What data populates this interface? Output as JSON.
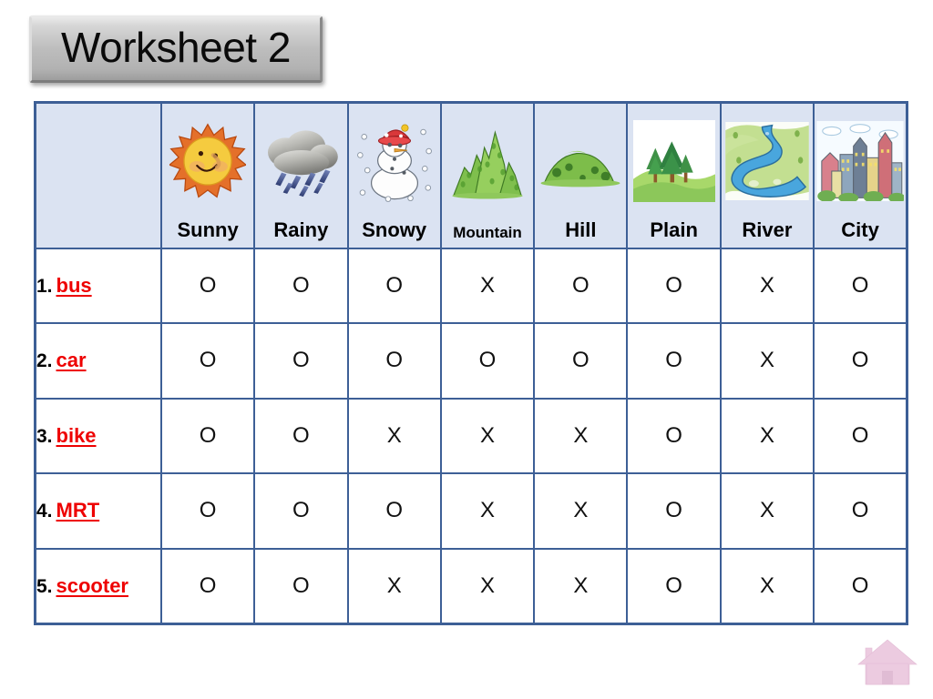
{
  "title": {
    "text": "Worksheet 2"
  },
  "table": {
    "corner_label": "",
    "columns": [
      {
        "label": "Sunny",
        "icon": "sun-icon",
        "label_size": "normal"
      },
      {
        "label": "Rainy",
        "icon": "rain-cloud-icon",
        "label_size": "normal"
      },
      {
        "label": "Snowy",
        "icon": "snowman-icon",
        "label_size": "normal"
      },
      {
        "label": "Mountain",
        "icon": "mountain-icon",
        "label_size": "small"
      },
      {
        "label": "Hill",
        "icon": "hill-icon",
        "label_size": "normal"
      },
      {
        "label": "Plain",
        "icon": "plain-icon",
        "label_size": "normal"
      },
      {
        "label": "River",
        "icon": "river-icon",
        "label_size": "normal"
      },
      {
        "label": "City",
        "icon": "city-icon",
        "label_size": "normal"
      }
    ],
    "rows": [
      {
        "num": "1.",
        "word": "bus",
        "marks": [
          "O",
          "O",
          "O",
          "X",
          "O",
          "O",
          "X",
          "O"
        ]
      },
      {
        "num": "2.",
        "word": "car",
        "marks": [
          "O",
          "O",
          "O",
          "O",
          "O",
          "O",
          "X",
          "O"
        ]
      },
      {
        "num": "3.",
        "word": "bike",
        "marks": [
          "O",
          "O",
          "X",
          "X",
          "X",
          "O",
          "X",
          "O"
        ]
      },
      {
        "num": "4.",
        "word": "MRT",
        "marks": [
          "O",
          "O",
          "O",
          "X",
          "X",
          "O",
          "X",
          "O"
        ]
      },
      {
        "num": "5.",
        "word": "scooter",
        "marks": [
          "O",
          "O",
          "X",
          "X",
          "X",
          "O",
          "X",
          "O"
        ]
      }
    ]
  },
  "home_button": {
    "icon": "home-icon"
  },
  "colors": {
    "table_border": "#3d5f96",
    "header_background": "#dbe3f2",
    "row_word": "#ee0000",
    "banner_face": "#bdbdbd",
    "home_icon": "#eccbe0"
  }
}
